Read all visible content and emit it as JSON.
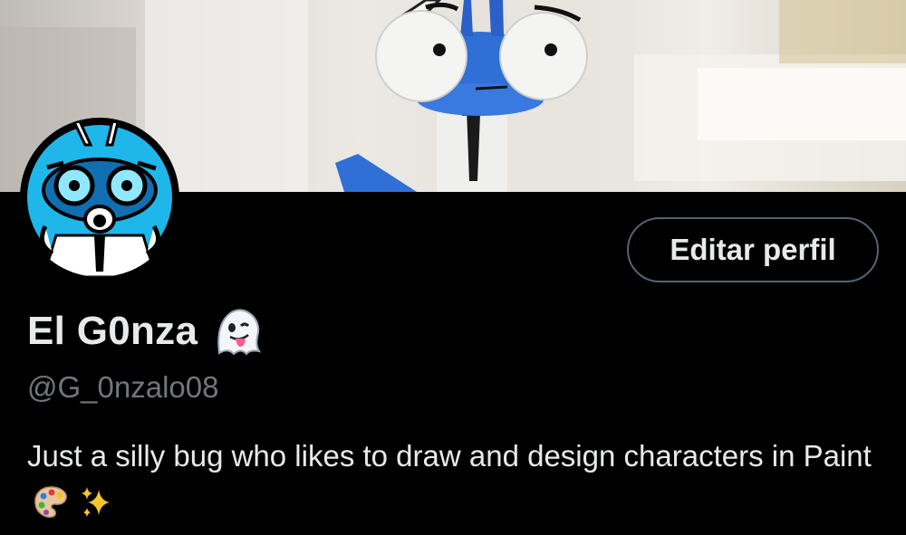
{
  "profile": {
    "display_name": "El G0nza",
    "name_emoji": "ghost-tongue-emoji",
    "handle": "@G_0nzalo08",
    "bio_text": "Just a silly bug who likes to draw and design characters in Paint",
    "bio_emojis": [
      "artist-palette-emoji",
      "sparkles-emoji"
    ],
    "edit_button_label": "Editar perfil"
  },
  "colors": {
    "background": "#000000",
    "primary_text": "#e7e9ea",
    "secondary_text": "#71767b",
    "button_border": "#536471",
    "avatar_accent": "#1fb6ea"
  }
}
